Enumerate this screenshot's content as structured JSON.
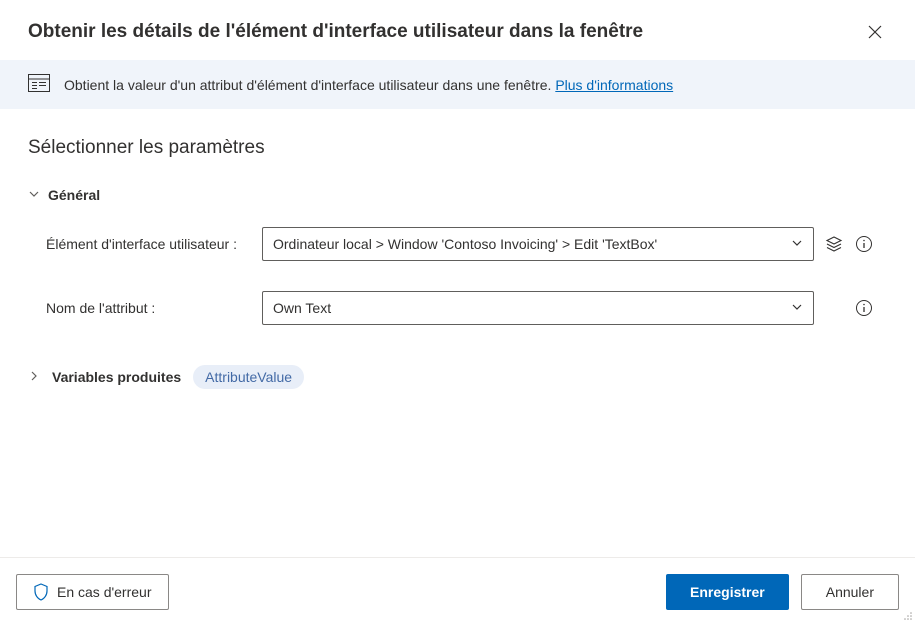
{
  "header": {
    "title": "Obtenir les détails de l'élément d'interface utilisateur dans la fenêtre"
  },
  "banner": {
    "text": "Obtient la valeur d'un attribut d'élément d'interface utilisateur dans une fenêtre. ",
    "link_text": "Plus d'informations"
  },
  "content": {
    "section_title": "Sélectionner les paramètres",
    "general": {
      "label": "Général",
      "ui_element_label": "Élément d'interface utilisateur :",
      "ui_element_value": "Ordinateur local > Window 'Contoso Invoicing' > Edit 'TextBox'",
      "attribute_label": "Nom de l'attribut :",
      "attribute_value": "Own Text"
    },
    "variables": {
      "label": "Variables produites",
      "badge": "AttributeValue"
    }
  },
  "footer": {
    "error_label": "En cas d'erreur",
    "save_label": "Enregistrer",
    "cancel_label": "Annuler"
  }
}
